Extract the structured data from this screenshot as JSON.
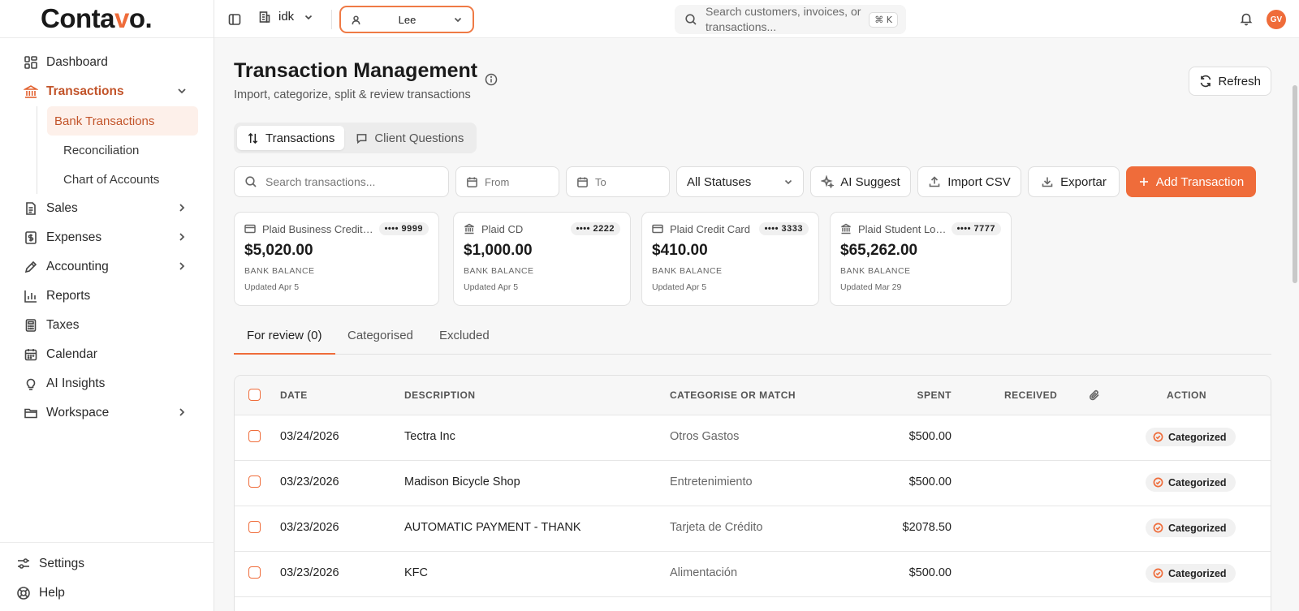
{
  "brand": {
    "prefix": "Conta",
    "accent": "v",
    "suffix": "o.",
    "accent_color": "#ef6c3a"
  },
  "sidebar": {
    "items": [
      {
        "label": "Dashboard",
        "icon": "dashboard-icon"
      },
      {
        "label": "Transactions",
        "icon": "bank-icon"
      },
      {
        "label": "Sales",
        "icon": "document-icon"
      },
      {
        "label": "Expenses",
        "icon": "dollar-receipt-icon"
      },
      {
        "label": "Accounting",
        "icon": "pen-icon"
      },
      {
        "label": "Reports",
        "icon": "bar-chart-icon"
      },
      {
        "label": "Taxes",
        "icon": "calculator-icon"
      },
      {
        "label": "Calendar",
        "icon": "calendar-icon"
      },
      {
        "label": "AI Insights",
        "icon": "lightbulb-icon"
      },
      {
        "label": "Workspace",
        "icon": "folder-icon"
      }
    ],
    "sub_items": [
      "Bank Transactions",
      "Reconciliation",
      "Chart of Accounts"
    ],
    "bottom": [
      {
        "label": "Settings",
        "icon": "sliders-icon"
      },
      {
        "label": "Help",
        "icon": "lifebuoy-icon"
      }
    ]
  },
  "topbar": {
    "workspace": "idk",
    "client": "Lee",
    "search_placeholder": "Search customers, invoices, or transactions...",
    "shortcut_symbol": "⌘",
    "shortcut_key": "K",
    "avatar": "GV"
  },
  "page": {
    "title": "Transaction Management",
    "subtitle": "Import, categorize, split & review transactions",
    "refresh": "Refresh"
  },
  "view_tabs": [
    "Transactions",
    "Client Questions"
  ],
  "filters": {
    "search_placeholder": "Search transactions...",
    "from": "From",
    "to": "To",
    "status": "All Statuses",
    "ai": "AI Suggest",
    "import": "Import CSV",
    "export": "Exportar",
    "add": "Add Transaction"
  },
  "accounts": [
    {
      "name": "Plaid Business Credit Card",
      "mask": "•••• 9999",
      "balance": "$5,020.00",
      "label": "BANK BALANCE",
      "updated": "Updated Apr 5",
      "icon": "credit-card-icon"
    },
    {
      "name": "Plaid CD",
      "mask": "•••• 2222",
      "balance": "$1,000.00",
      "label": "BANK BALANCE",
      "updated": "Updated Apr 5",
      "icon": "bank-icon"
    },
    {
      "name": "Plaid Credit Card",
      "mask": "•••• 3333",
      "balance": "$410.00",
      "label": "BANK BALANCE",
      "updated": "Updated Apr 5",
      "icon": "credit-card-icon"
    },
    {
      "name": "Plaid Student Loan",
      "mask": "•••• 7777",
      "balance": "$65,262.00",
      "label": "BANK BALANCE",
      "updated": "Updated Mar 29",
      "icon": "bank-icon"
    }
  ],
  "review_tabs": [
    "For review (0)",
    "Categorised",
    "Excluded"
  ],
  "table": {
    "headers": {
      "date": "DATE",
      "description": "DESCRIPTION",
      "category": "CATEGORISE OR MATCH",
      "spent": "SPENT",
      "received": "RECEIVED",
      "action": "ACTION"
    },
    "rows": [
      {
        "date": "03/24/2026",
        "description": "Tectra Inc",
        "category": "Otros Gastos",
        "spent": "$500.00",
        "received": "",
        "action": "Categorized"
      },
      {
        "date": "03/23/2026",
        "description": "Madison Bicycle Shop",
        "category": "Entretenimiento",
        "spent": "$500.00",
        "received": "",
        "action": "Categorized"
      },
      {
        "date": "03/23/2026",
        "description": "AUTOMATIC PAYMENT - THANK",
        "category": "Tarjeta de Crédito",
        "spent": "$2078.50",
        "received": "",
        "action": "Categorized"
      },
      {
        "date": "03/23/2026",
        "description": "KFC",
        "category": "Alimentación",
        "spent": "$500.00",
        "received": "",
        "action": "Categorized"
      }
    ]
  }
}
